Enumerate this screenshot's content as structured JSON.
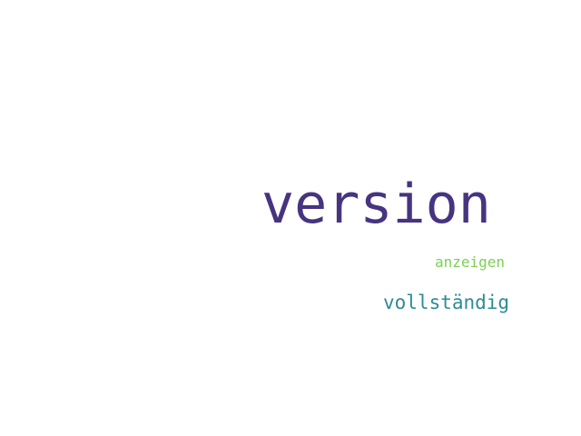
{
  "word_cloud": {
    "words": [
      {
        "text": "version",
        "color": "#463480"
      },
      {
        "text": "anzeigen",
        "color": "#7ad151"
      },
      {
        "text": "vollständig",
        "color": "#2c8c94"
      }
    ]
  }
}
